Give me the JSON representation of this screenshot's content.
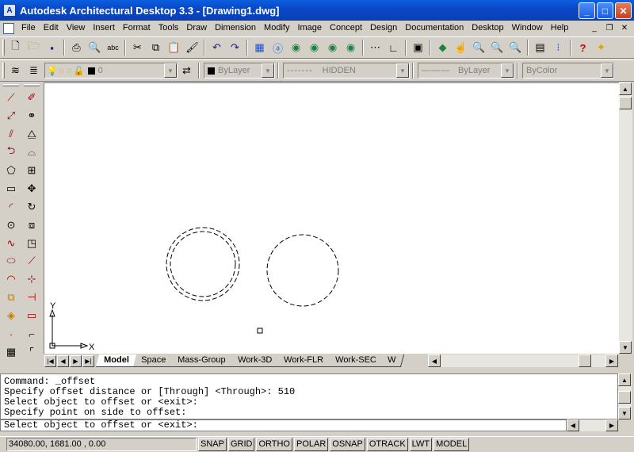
{
  "window": {
    "title": "Autodesk Architectural Desktop 3.3 - [Drawing1.dwg]",
    "minimize_label": "_",
    "maximize_label": "□",
    "close_label": "✕",
    "mdi_min": "_",
    "mdi_restore": "❐",
    "mdi_close": "✕"
  },
  "menu": [
    "File",
    "Edit",
    "View",
    "Insert",
    "Format",
    "Tools",
    "Draw",
    "Dimension",
    "Modify",
    "Image",
    "Concept",
    "Design",
    "Documentation",
    "Desktop",
    "Window",
    "Help"
  ],
  "properties_toolbar": {
    "layer_value": "0",
    "color_value": "ByLayer",
    "linetype_value": "HIDDEN",
    "linetype_pattern": "-------",
    "lineweight_value": "ByLayer",
    "lineweight_pattern": "———",
    "plotstyle_value": "ByColor"
  },
  "ucs": {
    "x_label": "X",
    "y_label": "Y"
  },
  "layout_tabs": [
    "Model",
    "Space",
    "Mass-Group",
    "Work-3D",
    "Work-FLR",
    "Work-SEC",
    "W"
  ],
  "command_history": [
    "Command: _offset",
    "Specify offset distance or [Through] <Through>: 510",
    "Select object to offset or <exit>:",
    "Specify point on side to offset:"
  ],
  "command_prompt": "Select object to offset or <exit>:",
  "status": {
    "coordinates": "34080.00, 1681.00 , 0.00",
    "toggles": [
      "SNAP",
      "GRID",
      "ORTHO",
      "POLAR",
      "OSNAP",
      "OTRACK",
      "LWT",
      "MODEL"
    ]
  },
  "colors": {
    "titlebar": "#0a48c8",
    "canvas": "#ffffff",
    "chrome": "#d4d0c8"
  }
}
